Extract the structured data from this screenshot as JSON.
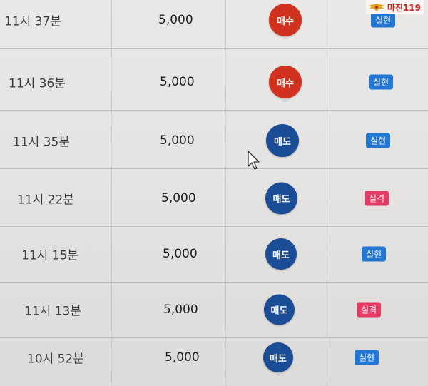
{
  "logo": {
    "text": "마진119"
  },
  "trades": [
    {
      "time": "11시 37분",
      "amount": "5,000",
      "side": "매수",
      "result": "실현"
    },
    {
      "time": "11시 36분",
      "amount": "5,000",
      "side": "매수",
      "result": "실현"
    },
    {
      "time": "11시 35분",
      "amount": "5,000",
      "side": "매도",
      "result": "실현"
    },
    {
      "time": "11시 22분",
      "amount": "5,000",
      "side": "매도",
      "result": "실격"
    },
    {
      "time": "11시 15분",
      "amount": "5,000",
      "side": "매도",
      "result": "실현"
    },
    {
      "time": "11시 13분",
      "amount": "5,000",
      "side": "매도",
      "result": "실격"
    },
    {
      "time": "10시 52분",
      "amount": "5,000",
      "side": "매도",
      "result": "실현"
    }
  ],
  "colors": {
    "buy": "#d1321f",
    "sell": "#1b4c96",
    "profit_badge": "#2277d3",
    "loss_badge": "#e33b64"
  }
}
